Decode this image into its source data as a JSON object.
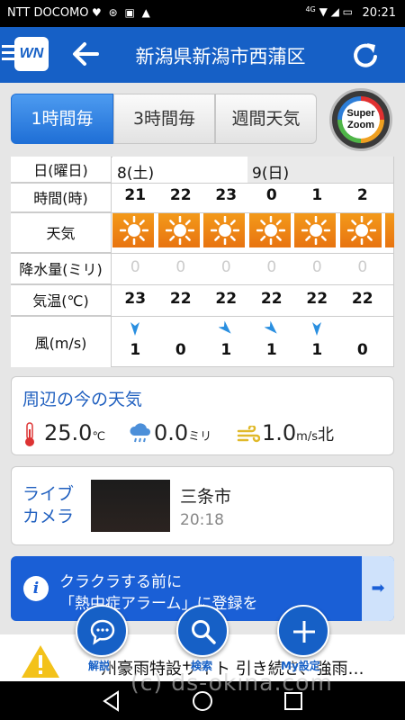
{
  "status_bar": {
    "carrier": "NTT DOCOMO",
    "time": "20:21",
    "net_label": "4G"
  },
  "header": {
    "title": "新潟県新潟市西蒲区",
    "logo_text": "WN"
  },
  "tabs": [
    {
      "label": "1時間毎",
      "active": true
    },
    {
      "label": "3時間毎",
      "active": false
    },
    {
      "label": "週間天気",
      "active": false
    }
  ],
  "super_zoom": {
    "line1": "Super",
    "line2": "Zoom"
  },
  "forecast": {
    "row_labels": {
      "date": "日(曜日)",
      "hour": "時間(時)",
      "weather": "天気",
      "precip": "降水量(ミリ)",
      "temp": "気温(℃)",
      "wind": "風(m/s)"
    },
    "dates": [
      {
        "label": "8(土)"
      },
      {
        "label": "9(日)"
      }
    ],
    "hours": [
      "21",
      "22",
      "23",
      "0",
      "1",
      "2"
    ],
    "weather_icons": [
      "sun-icon",
      "sun-icon",
      "sun-icon",
      "sun-icon",
      "sun-icon",
      "sun-icon"
    ],
    "precip": [
      "0",
      "0",
      "0",
      "0",
      "0",
      "0"
    ],
    "temp": [
      "23",
      "22",
      "22",
      "22",
      "22",
      "22"
    ],
    "wind": [
      "1",
      "0",
      "1",
      "1",
      "1",
      "0"
    ],
    "wind_dirs": [
      "south",
      "none",
      "southeast",
      "southeast",
      "south",
      "none"
    ]
  },
  "current": {
    "title": "周辺の今の天気",
    "temp": "25.0",
    "temp_unit": "℃",
    "rain": "0.0",
    "rain_unit": "ミリ",
    "wind": "1.0",
    "wind_unit": "m/s",
    "wind_dir": "北"
  },
  "live_camera": {
    "label": "ライブカメラ",
    "city": "三条市",
    "time": "20:18"
  },
  "banner": {
    "line1": "クラクラする前に",
    "line2": "「熱中症アラーム」に登録を"
  },
  "ticker": {
    "text": "州豪雨特設サイト 引き続き、強雨…"
  },
  "fabs": [
    {
      "label": "解説"
    },
    {
      "label": "検索"
    },
    {
      "label": "My設定"
    }
  ],
  "watermark": "(c) ds-okina.com",
  "colors": {
    "brand_blue": "#1660c6",
    "sun_orange": "#ef8a16",
    "accent_blue_text": "#1f5fbf"
  }
}
